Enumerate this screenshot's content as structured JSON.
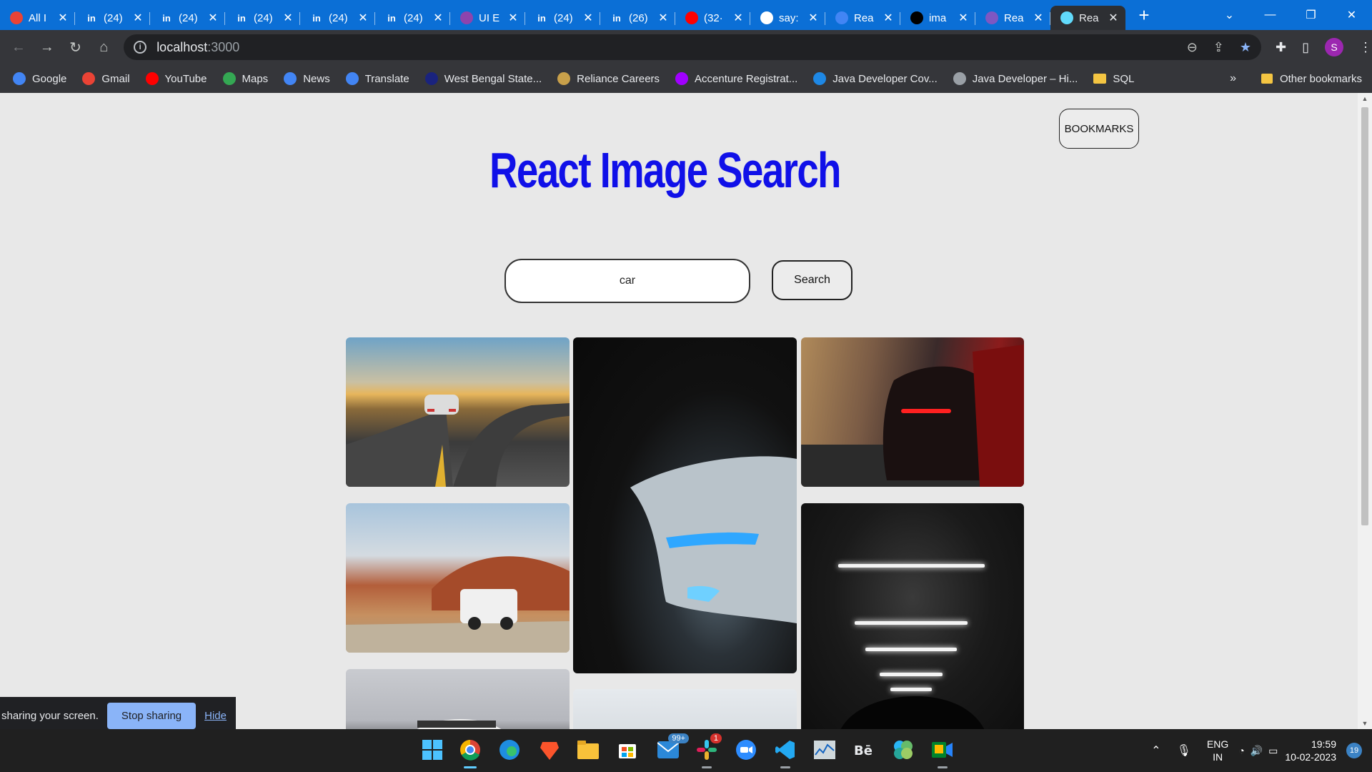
{
  "browser": {
    "tabs": [
      {
        "title": "All I",
        "icon": "gmail-icon",
        "color": "#ea4335"
      },
      {
        "title": "(24)",
        "icon": "linkedin-icon",
        "color": "#0a66c2"
      },
      {
        "title": "(24)",
        "icon": "linkedin-icon",
        "color": "#0a66c2"
      },
      {
        "title": "(24)",
        "icon": "linkedin-icon",
        "color": "#0a66c2"
      },
      {
        "title": "(24)",
        "icon": "linkedin-icon",
        "color": "#0a66c2"
      },
      {
        "title": "(24)",
        "icon": "linkedin-icon",
        "color": "#0a66c2"
      },
      {
        "title": "UI E",
        "icon": "ui-icon",
        "color": "#8e44ad"
      },
      {
        "title": "(24)",
        "icon": "linkedin-icon",
        "color": "#0a66c2"
      },
      {
        "title": "(26)",
        "icon": "linkedin-icon",
        "color": "#0a66c2"
      },
      {
        "title": "(32·",
        "icon": "youtube-icon",
        "color": "#ff0000"
      },
      {
        "title": "say:",
        "icon": "github-icon",
        "color": "#ffffff"
      },
      {
        "title": "Rea",
        "icon": "docs-icon",
        "color": "#4285f4"
      },
      {
        "title": "ima",
        "icon": "unsplash-icon",
        "color": "#000000"
      },
      {
        "title": "Rea",
        "icon": "forms-icon",
        "color": "#7e57c2"
      },
      {
        "title": "Rea",
        "icon": "react-icon",
        "color": "#61dafb",
        "active": true
      }
    ],
    "new_tab_label": "+",
    "url_host": "localhost",
    "url_port": ":3000",
    "profile_initial": "S",
    "bookmarks": [
      {
        "label": "Google",
        "icon": "google-icon",
        "color": "#4285f4"
      },
      {
        "label": "Gmail",
        "icon": "gmail-icon",
        "color": "#ea4335"
      },
      {
        "label": "YouTube",
        "icon": "youtube-icon",
        "color": "#ff0000"
      },
      {
        "label": "Maps",
        "icon": "maps-icon",
        "color": "#34a853"
      },
      {
        "label": "News",
        "icon": "news-icon",
        "color": "#4285f4"
      },
      {
        "label": "Translate",
        "icon": "translate-icon",
        "color": "#4285f4"
      },
      {
        "label": "West Bengal State...",
        "icon": "wb-icon",
        "color": "#1a237e"
      },
      {
        "label": "Reliance Careers",
        "icon": "reliance-icon",
        "color": "#c8a04a"
      },
      {
        "label": "Accenture Registrat...",
        "icon": "accenture-icon",
        "color": "#a100ff"
      },
      {
        "label": "Java Developer Cov...",
        "icon": "bing-icon",
        "color": "#1e88e5"
      },
      {
        "label": "Java Developer – Hi...",
        "icon": "globe-icon",
        "color": "#9aa0a6"
      },
      {
        "label": "SQL",
        "icon": "folder-icon",
        "color": "#f4c542"
      }
    ],
    "more_bookmarks": "»",
    "other_bookmarks": "Other bookmarks"
  },
  "app": {
    "title": "React Image Search",
    "bookmarks_button": "BOOKMARKS",
    "search_value": "car",
    "search_button": "Search"
  },
  "sharing": {
    "text": "sharing your screen.",
    "stop": "Stop sharing",
    "hide": "Hide"
  },
  "taskbar": {
    "mail_badge": "99+",
    "slack_badge": "1",
    "language": "ENG",
    "region": "IN",
    "time": "19:59",
    "date": "10-02-2023",
    "notifications": "19"
  }
}
